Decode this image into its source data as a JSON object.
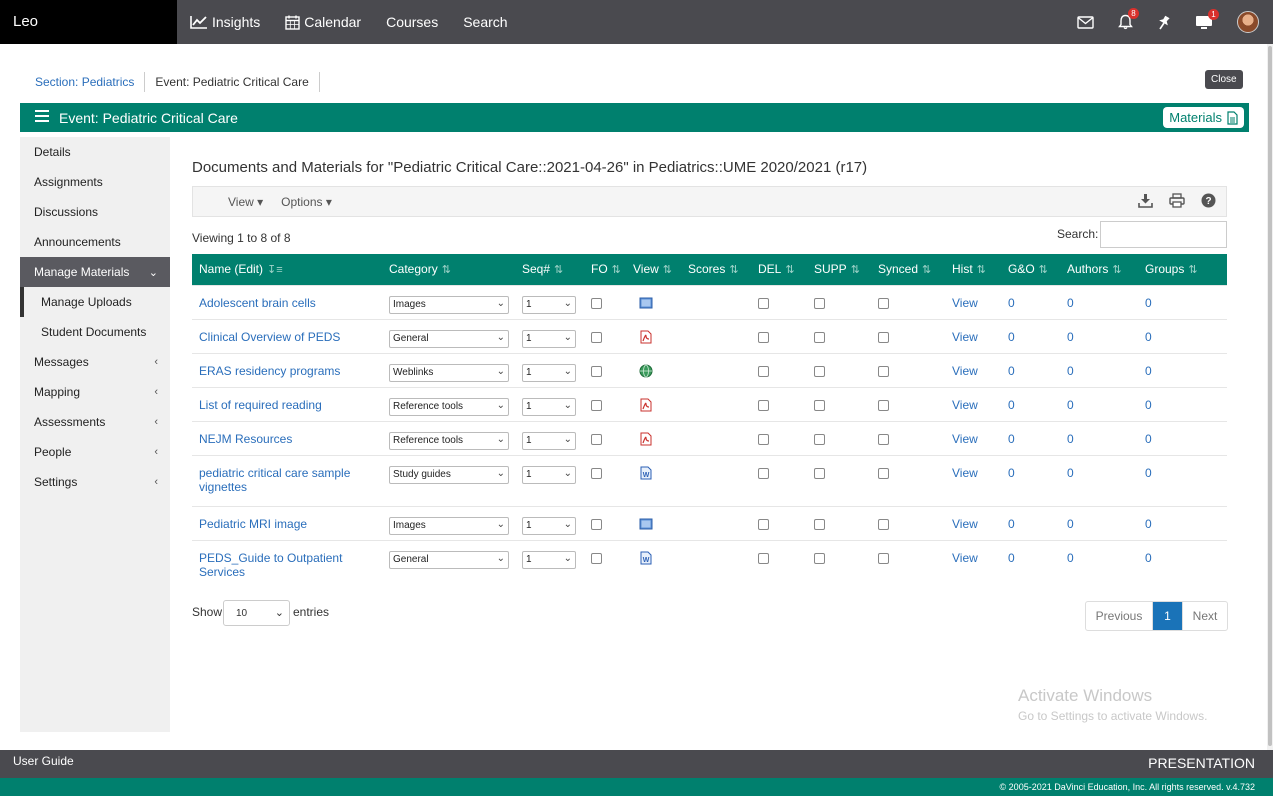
{
  "brand": "Leo",
  "topnav": [
    {
      "label": "Insights",
      "icon": "chart-line-icon"
    },
    {
      "label": "Calendar",
      "icon": "calendar-icon"
    },
    {
      "label": "Courses"
    },
    {
      "label": "Search"
    }
  ],
  "topicons": {
    "notifications_badge": "8",
    "presentation_badge": "1"
  },
  "breadcrumb": {
    "section": "Section: Pediatrics",
    "event": "Event: Pediatric Critical Care"
  },
  "close_label": "Close",
  "eventbar": {
    "title": "Event: Pediatric Critical Care",
    "materials_label": "Materials"
  },
  "sidebar": {
    "items": [
      {
        "label": "Details"
      },
      {
        "label": "Assignments"
      },
      {
        "label": "Discussions"
      },
      {
        "label": "Announcements"
      },
      {
        "label": "Manage Materials"
      },
      {
        "label": "Manage Uploads"
      },
      {
        "label": "Student Documents"
      },
      {
        "label": "Messages"
      },
      {
        "label": "Mapping"
      },
      {
        "label": "Assessments"
      },
      {
        "label": "People"
      },
      {
        "label": "Settings"
      }
    ]
  },
  "main": {
    "title": "Documents and Materials for \"Pediatric Critical Care::2021-04-26\" in Pediatrics::UME 2020/2021 (r17)",
    "toolbar": {
      "view_label": "View",
      "options_label": "Options"
    },
    "viewing": "Viewing 1 to 8 of 8",
    "search_label": "Search:",
    "search_value": "",
    "columns": [
      "Name (Edit)",
      "Category",
      "Seq#",
      "FO",
      "View",
      "Scores",
      "DEL",
      "SUPP",
      "Synced",
      "Hist",
      "G&O",
      "Authors",
      "Groups"
    ],
    "rows": [
      {
        "name": "Adolescent brain cells",
        "category": "Images",
        "seq": "1",
        "file_icon": "image-file-icon",
        "hist": "View",
        "go": "0",
        "authors": "0",
        "groups": "0"
      },
      {
        "name": "Clinical Overview of PEDS",
        "category": "General",
        "seq": "1",
        "file_icon": "pdf-file-icon",
        "hist": "View",
        "go": "0",
        "authors": "0",
        "groups": "0"
      },
      {
        "name": "ERAS residency programs",
        "category": "Weblinks",
        "seq": "1",
        "file_icon": "weblink-globe-icon",
        "hist": "View",
        "go": "0",
        "authors": "0",
        "groups": "0"
      },
      {
        "name": "List of required reading",
        "category": "Reference tools",
        "seq": "1",
        "file_icon": "pdf-file-icon",
        "hist": "View",
        "go": "0",
        "authors": "0",
        "groups": "0"
      },
      {
        "name": "NEJM Resources",
        "category": "Reference tools",
        "seq": "1",
        "file_icon": "pdf-file-icon",
        "hist": "View",
        "go": "0",
        "authors": "0",
        "groups": "0"
      },
      {
        "name": "pediatric critical care sample vignettes",
        "category": "Study guides",
        "seq": "1",
        "file_icon": "word-file-icon",
        "hist": "View",
        "go": "0",
        "authors": "0",
        "groups": "0"
      },
      {
        "name": "Pediatric MRI image",
        "category": "Images",
        "seq": "1",
        "file_icon": "image-file-icon",
        "hist": "View",
        "go": "0",
        "authors": "0",
        "groups": "0"
      },
      {
        "name": "PEDS_Guide to Outpatient Services",
        "category": "General",
        "seq": "1",
        "file_icon": "word-file-icon",
        "hist": "View",
        "go": "0",
        "authors": "0",
        "groups": "0"
      }
    ],
    "show_label": "Show",
    "show_value": "10",
    "entries_label": "entries",
    "pagination": {
      "previous": "Previous",
      "current": "1",
      "next": "Next"
    }
  },
  "watermark": {
    "line1": "Activate Windows",
    "line2": "Go to Settings to activate Windows."
  },
  "footer": {
    "user_guide": "User Guide",
    "presentation": "PRESENTATION",
    "copyright": "© 2005-2021 DaVinci Education, Inc. All rights reserved. v.4.732"
  },
  "colors": {
    "teal": "#00806e",
    "topbar": "#4a4a4f",
    "link": "#2a6ebb",
    "active_page": "#1a73b8"
  }
}
